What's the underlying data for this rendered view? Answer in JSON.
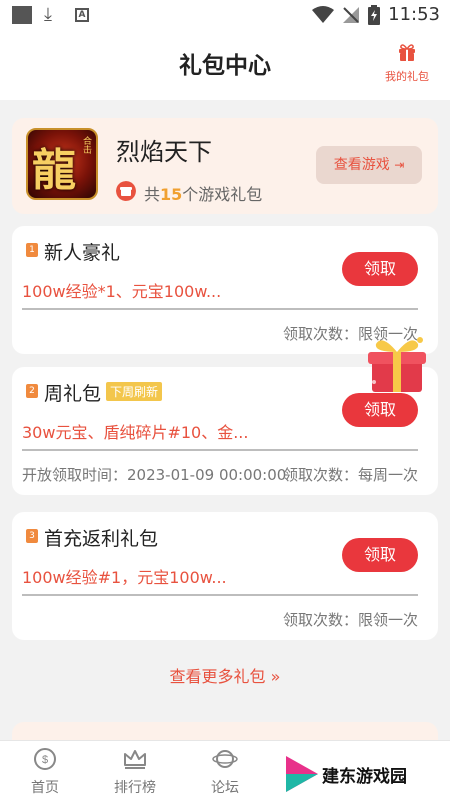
{
  "status_bar": {
    "time": "11:53",
    "mini_icon_letter": "A"
  },
  "header": {
    "title": "礼包中心",
    "my_gifts_label": "我的礼包"
  },
  "game": {
    "name": "烈焰天下",
    "icon_char": "龍",
    "icon_sub_text": "合击",
    "gift_count_prefix": "共",
    "gift_count": "15",
    "gift_count_suffix": "个游戏礼包",
    "view_game_label": "查看游戏"
  },
  "gifts": [
    {
      "rank": "1",
      "name": "新人豪礼",
      "tag": "",
      "contents": "100w经验*1、元宝100w...",
      "claim_label": "领取",
      "limit": "领取次数：限领一次",
      "open_time": ""
    },
    {
      "rank": "2",
      "name": "周礼包",
      "tag": "下周刷新",
      "contents": "30w元宝、盾纯碎片#10、金...",
      "claim_label": "领取",
      "limit": "领取次数：每周一次",
      "open_time": "开放领取时间：2023-01-09 00:00:00"
    },
    {
      "rank": "3",
      "name": "首充返利礼包",
      "tag": "",
      "contents": "100w经验#1，元宝100w...",
      "claim_label": "领取",
      "limit": "领取次数：限领一次",
      "open_time": ""
    }
  ],
  "more_label": "查看更多礼包 »",
  "tabs": [
    {
      "label": "首页"
    },
    {
      "label": "排行榜"
    },
    {
      "label": "论坛"
    }
  ],
  "watermark": {
    "text": "建东游戏园"
  },
  "colors": {
    "accent": "#e8523f",
    "claim_button": "#e9373d",
    "tag_bg": "#f3c64c",
    "card_tint": "#fdf1ea"
  }
}
